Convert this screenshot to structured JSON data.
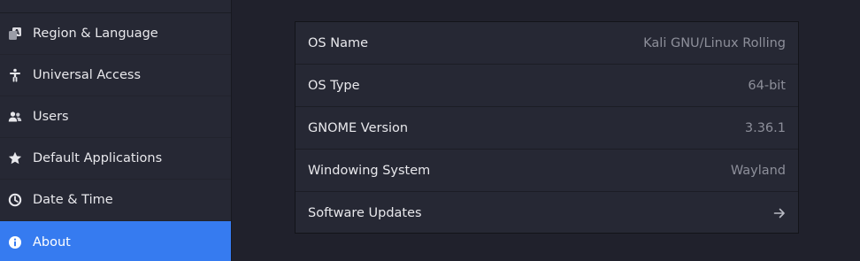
{
  "sidebar": {
    "items": [
      {
        "label": "Region & Language",
        "icon": "region-language-icon"
      },
      {
        "label": "Universal Access",
        "icon": "accessibility-icon"
      },
      {
        "label": "Users",
        "icon": "users-icon"
      },
      {
        "label": "Default Applications",
        "icon": "star-icon"
      },
      {
        "label": "Date & Time",
        "icon": "clock-icon"
      },
      {
        "label": "About",
        "icon": "info-icon",
        "active": true
      }
    ]
  },
  "about": {
    "rows": [
      {
        "label": "OS Name",
        "value": "Kali GNU/Linux Rolling"
      },
      {
        "label": "OS Type",
        "value": "64-bit"
      },
      {
        "label": "GNOME Version",
        "value": "3.36.1"
      },
      {
        "label": "Windowing System",
        "value": "Wayland"
      },
      {
        "label": "Software Updates",
        "icon": "arrow-right-icon"
      }
    ]
  },
  "colors": {
    "accent": "#367bf0",
    "sidebar_bg": "#262834",
    "main_bg": "#20212c",
    "value_text": "#8d8f9a"
  }
}
